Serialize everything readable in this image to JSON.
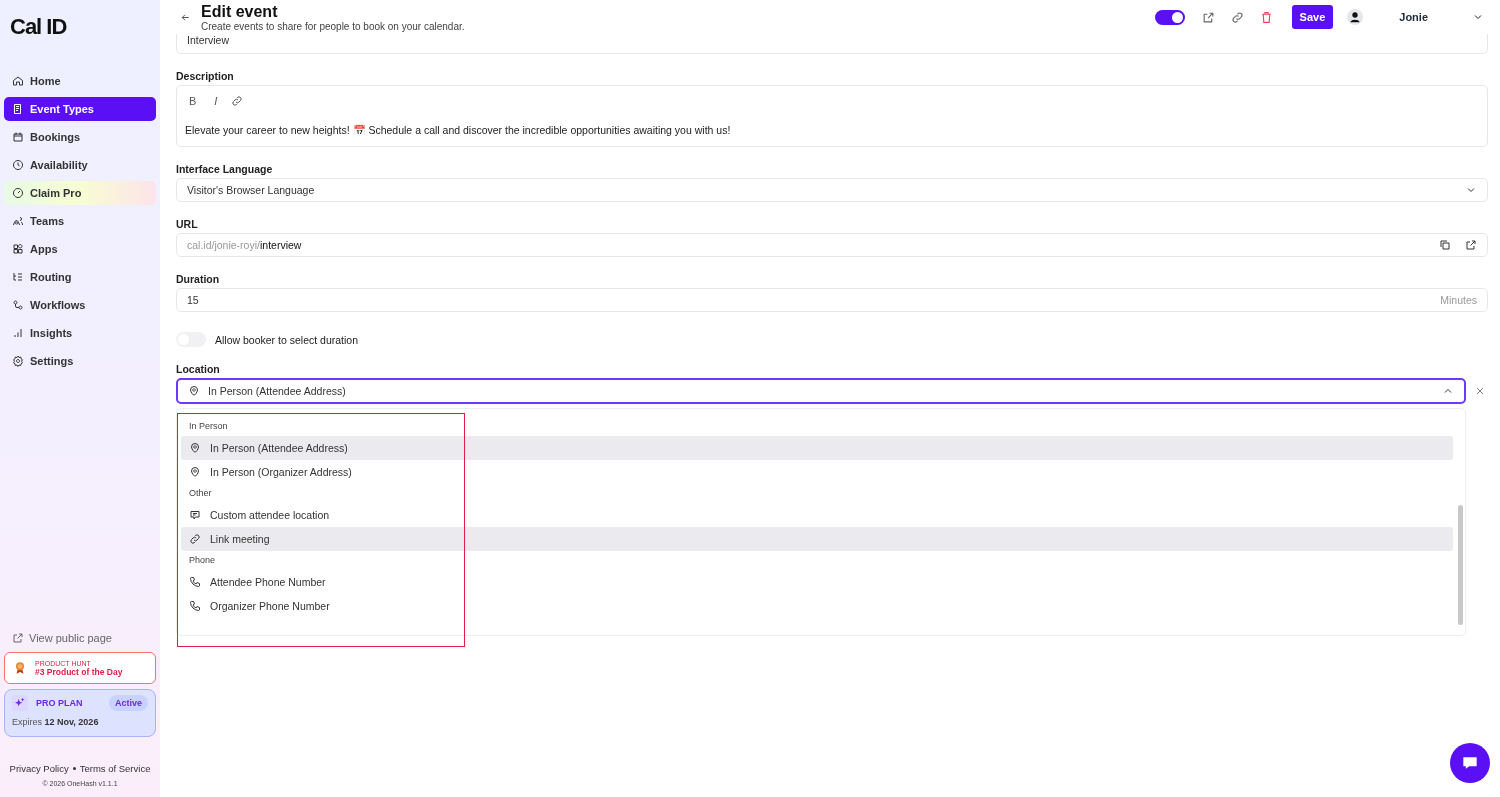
{
  "sidebar": {
    "logo": "Cal ID",
    "items": [
      {
        "label": "Home",
        "selected": false,
        "kind": "nav"
      },
      {
        "label": "Event Types",
        "selected": true,
        "kind": "nav"
      },
      {
        "label": "Bookings",
        "selected": false,
        "kind": "nav"
      },
      {
        "label": "Availability",
        "selected": false,
        "kind": "nav"
      },
      {
        "label": "Claim Pro",
        "selected": false,
        "kind": "promo"
      },
      {
        "label": "Teams",
        "selected": false,
        "kind": "nav"
      },
      {
        "label": "Apps",
        "selected": false,
        "kind": "nav"
      },
      {
        "label": "Routing",
        "selected": false,
        "kind": "nav"
      },
      {
        "label": "Workflows",
        "selected": false,
        "kind": "nav"
      },
      {
        "label": "Insights",
        "selected": false,
        "kind": "nav"
      },
      {
        "label": "Settings",
        "selected": false,
        "kind": "nav"
      }
    ],
    "public_link": "View public page",
    "product_hunt": {
      "eyebrow": "PRODUCT HUNT",
      "title": "#3 Product of the Day"
    },
    "plan": {
      "name": "PRO PLAN",
      "badge": "Active",
      "expires_label": "Expires",
      "expires_date": "12 Nov, 2026"
    },
    "footer_links": [
      "Privacy Policy",
      "Terms of Service"
    ],
    "copyright": "© 2026 OneHash v1.1.1"
  },
  "header": {
    "title": "Edit event",
    "subtitle": "Create events to share for people to book on your calendar.",
    "enabled": true,
    "save": "Save",
    "user": "Jonie"
  },
  "form": {
    "title_value": "Interview",
    "description": {
      "label": "Description",
      "toolbar": [
        "B",
        "I"
      ],
      "text": "Elevate your career to new heights! 📅 Schedule a call and discover the incredible opportunities awaiting you with us!"
    },
    "language": {
      "label": "Interface Language",
      "value": "Visitor's Browser Language"
    },
    "url": {
      "label": "URL",
      "prefix": "cal.id/jonie-royi/",
      "slug": "interview"
    },
    "duration": {
      "label": "Duration",
      "value": "15",
      "suffix": "Minutes"
    },
    "allow_duration": {
      "label": "Allow booker to select duration",
      "on": false
    },
    "location": {
      "label": "Location",
      "value": "In Person (Attendee Address)",
      "expanded": true
    }
  },
  "dropdown": {
    "groups": [
      {
        "heading": "In Person",
        "options": [
          {
            "label": "In Person (Attendee Address)",
            "kind": "address",
            "selected": true
          },
          {
            "label": "In Person (Organizer Address)",
            "kind": "address",
            "selected": false
          }
        ]
      },
      {
        "heading": "Other",
        "options": [
          {
            "label": "Custom attendee location",
            "kind": "custom",
            "selected": false
          },
          {
            "label": "Link meeting",
            "kind": "link",
            "selected": true
          }
        ]
      },
      {
        "heading": "Phone",
        "options": [
          {
            "label": "Attendee Phone Number",
            "kind": "phone",
            "selected": false
          },
          {
            "label": "Organizer Phone Number",
            "kind": "phone",
            "selected": false
          }
        ]
      }
    ]
  }
}
